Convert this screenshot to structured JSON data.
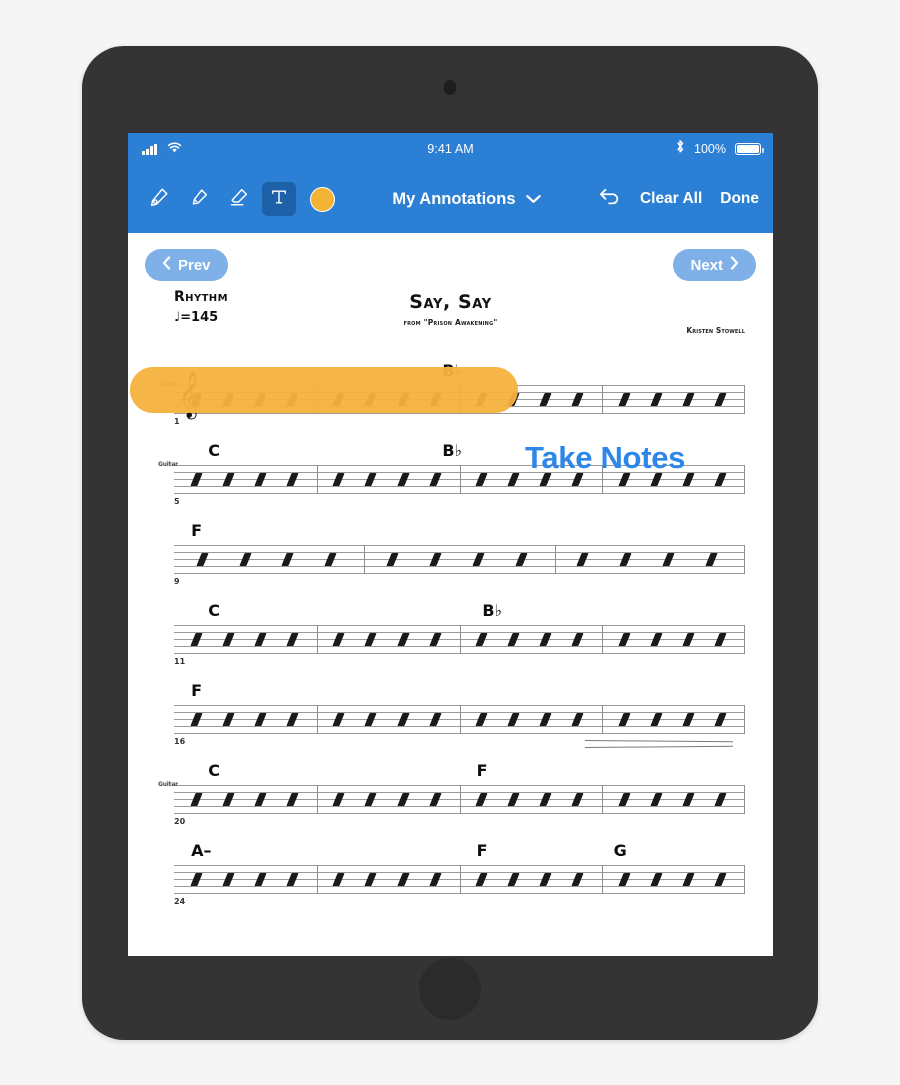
{
  "status_bar": {
    "time": "9:41 AM",
    "battery_percent": "100%",
    "icons": [
      "signal-bars-icon",
      "wifi-icon",
      "bluetooth-icon",
      "battery-icon"
    ]
  },
  "toolbar": {
    "tools": [
      {
        "name": "pen-tool",
        "icon": "pen-icon",
        "active": false
      },
      {
        "name": "highlighter-tool",
        "icon": "highlighter-icon",
        "active": false
      },
      {
        "name": "eraser-tool",
        "icon": "eraser-icon",
        "active": false
      },
      {
        "name": "text-tool",
        "icon": "text-t-icon",
        "active": true
      }
    ],
    "color_swatch": "#f5b335",
    "document_name": "My Annotations",
    "undo_label": "undo-icon",
    "clear_all_label": "Clear All",
    "done_label": "Done"
  },
  "navigation": {
    "prev_label": "Prev",
    "next_label": "Next"
  },
  "score": {
    "title": "Say, Say",
    "subtitle": "from \"Prison Awakening\"",
    "style": "Rhythm",
    "tempo": "♩=145",
    "composer": "Kristen Stowell",
    "instrument_label": "Guitar",
    "systems": [
      {
        "measure_start": "1",
        "chords": [
          {
            "text": "B♭",
            "left_pct": 47
          }
        ],
        "bars": 4,
        "has_clef": true
      },
      {
        "measure_start": "5",
        "chords": [
          {
            "text": "C",
            "left_pct": 6
          },
          {
            "text": "B♭",
            "left_pct": 47
          }
        ],
        "bars": 4,
        "has_clef": false
      },
      {
        "measure_start": "9",
        "chords": [
          {
            "text": "F",
            "left_pct": 3
          }
        ],
        "bars": 3,
        "has_clef": false
      },
      {
        "measure_start": "11",
        "chords": [
          {
            "text": "C",
            "left_pct": 6
          },
          {
            "text": "B♭",
            "left_pct": 54
          }
        ],
        "bars": 4,
        "has_clef": false
      },
      {
        "measure_start": "16",
        "chords": [
          {
            "text": "F",
            "left_pct": 3
          }
        ],
        "bars": 4,
        "has_clef": false
      },
      {
        "measure_start": "20",
        "chords": [
          {
            "text": "C",
            "left_pct": 6
          },
          {
            "text": "F",
            "left_pct": 53
          }
        ],
        "bars": 4,
        "has_clef": false
      },
      {
        "measure_start": "24",
        "chords": [
          {
            "text": "A–",
            "left_pct": 3
          },
          {
            "text": "F",
            "left_pct": 53
          },
          {
            "text": "G",
            "left_pct": 77
          }
        ],
        "bars": 4,
        "has_clef": false
      }
    ]
  },
  "annotations": {
    "highlight": {
      "color": "#f5b23d"
    },
    "text_note": {
      "content": "Take Notes",
      "color": "#2d87e8"
    }
  }
}
